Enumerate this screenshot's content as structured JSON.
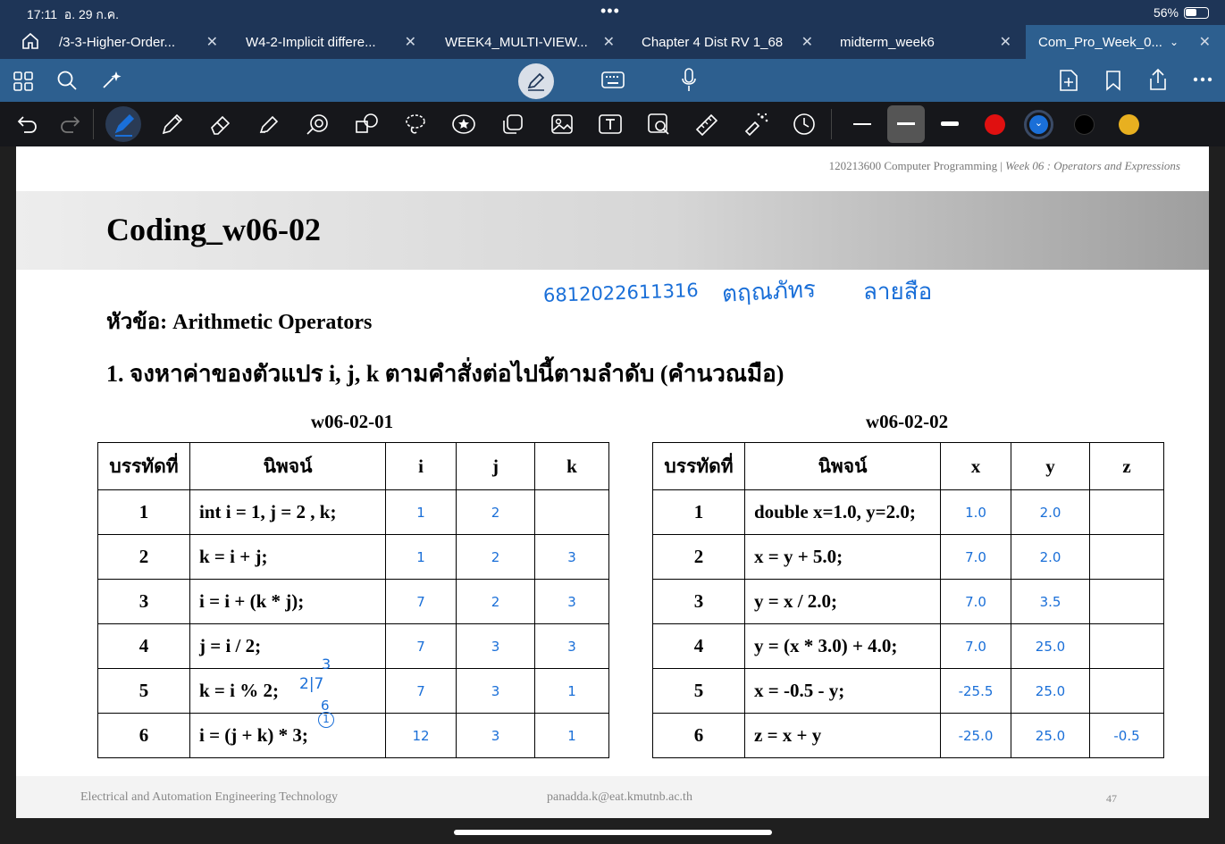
{
  "status": {
    "time": "17:11",
    "date": "อ. 29 ก.ค.",
    "dots": "•••",
    "battery": "56%"
  },
  "tabs": [
    {
      "label": "/3-3-Higher-Order...",
      "active": false
    },
    {
      "label": "W4-2-Implicit differe...",
      "active": false
    },
    {
      "label": "WEEK4_MULTI-VIEW...",
      "active": false
    },
    {
      "label": "Chapter 4 Dist RV 1_68",
      "active": false
    },
    {
      "label": "midterm_week6",
      "active": false
    },
    {
      "label": "Com_Pro_Week_0...",
      "active": true
    }
  ],
  "colors": {
    "tabbar": "#1e3557",
    "toolbar": "#2d5f8f",
    "pen": "#1a6fd8",
    "red": "#e01010",
    "blue": "#1a6fd8",
    "black": "#000000",
    "yellow": "#e8b020"
  },
  "document": {
    "header": "120213600 Computer Programming |",
    "header_italic": "Week 06 : Operators and Expressions",
    "title": "Coding_w06-02",
    "topic": "หัวข้อ: Arithmetic Operators",
    "question": "1. จงหาค่าของตัวแปร i, j, k ตามคำสั่งต่อไปนี้ตามลำดับ (คำนวณมือ)",
    "handwritten": {
      "student_id": "6812022611316",
      "first_name": "ตฤณภัทร",
      "last_name": "ลายสือ"
    },
    "table1": {
      "caption": "w06-02-01",
      "headers": [
        "บรรทัดที่",
        "นิพจน์",
        "i",
        "j",
        "k"
      ],
      "rows": [
        {
          "line": "1",
          "expr": "int i = 1, j = 2 , k;",
          "a": "1",
          "b": "2",
          "c": ""
        },
        {
          "line": "2",
          "expr": "k = i + j;",
          "a": "1",
          "b": "2",
          "c": "3"
        },
        {
          "line": "3",
          "expr": "i = i + (k * j);",
          "a": "7",
          "b": "2",
          "c": "3"
        },
        {
          "line": "4",
          "expr": "j = i / 2;",
          "a": "7",
          "b": "3",
          "c": "3"
        },
        {
          "line": "5",
          "expr": "k = i % 2;",
          "a": "7",
          "b": "3",
          "c": "1"
        },
        {
          "line": "6",
          "expr": "i = (j + k) * 3;",
          "a": "12",
          "b": "3",
          "c": "1"
        }
      ],
      "scratch": {
        "top": "3",
        "divisor": "2|7",
        "bottom": "6",
        "remainder": "1"
      }
    },
    "table2": {
      "caption": "w06-02-02",
      "headers": [
        "บรรทัดที่",
        "นิพจน์",
        "x",
        "y",
        "z"
      ],
      "rows": [
        {
          "line": "1",
          "expr": "double x=1.0, y=2.0;",
          "a": "1.0",
          "b": "2.0",
          "c": ""
        },
        {
          "line": "2",
          "expr": "x = y + 5.0;",
          "a": "7.0",
          "b": "2.0",
          "c": ""
        },
        {
          "line": "3",
          "expr": "y = x / 2.0;",
          "a": "7.0",
          "b": "3.5",
          "c": ""
        },
        {
          "line": "4",
          "expr": "y = (x * 3.0) + 4.0;",
          "a": "7.0",
          "b": "25.0",
          "c": ""
        },
        {
          "line": "5",
          "expr": "x = -0.5 - y;",
          "a": "-25.5",
          "b": "25.0",
          "c": ""
        },
        {
          "line": "6",
          "expr": "z = x + y",
          "a": "-25.0",
          "b": "25.0",
          "c": "-0.5"
        }
      ]
    },
    "footer": {
      "left": "Electrical and Automation Engineering Technology",
      "center": "panadda.k@eat.kmutnb.ac.th",
      "page": "47"
    }
  }
}
